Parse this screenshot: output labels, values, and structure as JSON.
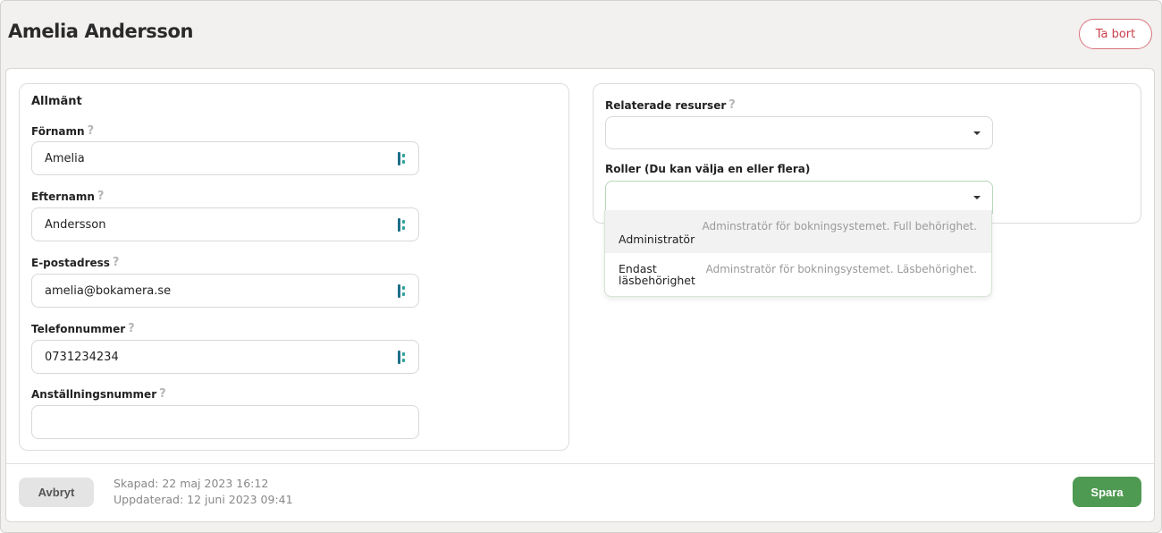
{
  "header": {
    "title": "Amelia Andersson",
    "delete_label": "Ta bort"
  },
  "general": {
    "section_title": "Allmänt",
    "help_glyph": "?",
    "first_name": {
      "label": "Förnamn",
      "value": "Amelia"
    },
    "last_name": {
      "label": "Efternamn",
      "value": "Andersson"
    },
    "email": {
      "label": "E-postadress",
      "value": "amelia@bokamera.se"
    },
    "phone": {
      "label": "Telefonnummer",
      "value": "0731234234"
    },
    "employee_number": {
      "label": "Anställningsnummer",
      "value": ""
    }
  },
  "related": {
    "resources_label": "Relaterade resurser",
    "roles_label": "Roller (Du kan välja en eller flera)",
    "role_options": [
      {
        "label": "Administratör",
        "description": "Adminstratör för bokningsystemet. Full behörighet."
      },
      {
        "label_line1": "Endast",
        "label_line2": "läsbehörighet",
        "description": "Adminstratör för bokningsystemet. Läsbehörighet."
      }
    ]
  },
  "footer": {
    "cancel_label": "Avbryt",
    "created": "Skapad: 22 maj 2023 16:12",
    "updated": "Uppdaterad: 12 juni 2023 09:41",
    "save_label": "Spara"
  },
  "colors": {
    "danger": "#c9404c",
    "primary": "#4f9a52",
    "autofill_icon": "#1e6f8a"
  }
}
